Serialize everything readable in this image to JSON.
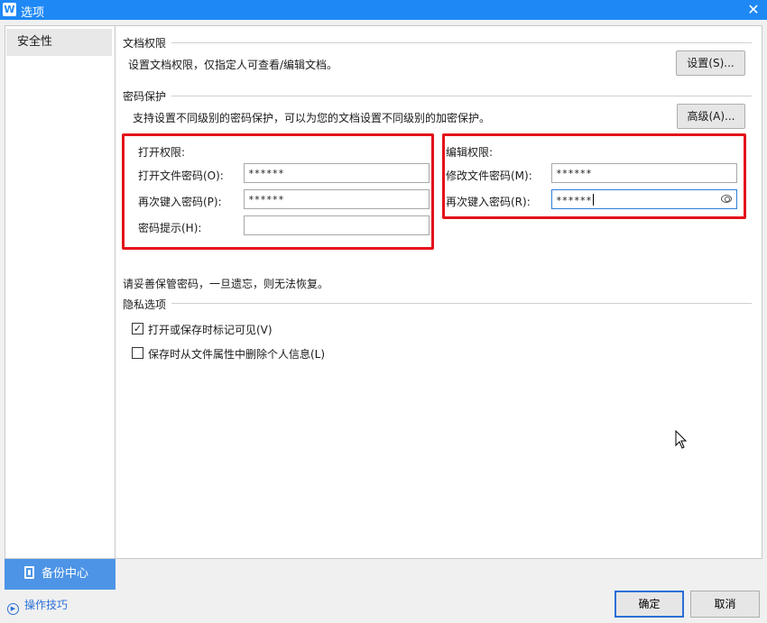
{
  "window": {
    "title": "选项",
    "app_icon_letter": "W",
    "close_glyph": "✕"
  },
  "sidebar": {
    "items": [
      {
        "label": "安全性",
        "selected": true
      }
    ],
    "backup_label": "备份中心",
    "tips_label": "操作技巧"
  },
  "doc_permission": {
    "title": "文档权限",
    "desc": "设置文档权限，仅指定人可查看/编辑文档。",
    "button": "设置(S)..."
  },
  "password": {
    "title": "密码保护",
    "desc": "支持设置不同级别的密码保护，可以为您的文档设置不同级别的加密保护。",
    "advanced_button": "高级(A)...",
    "open": {
      "title": "打开权限:",
      "password_label": "打开文件密码(O):",
      "password_value": "******",
      "confirm_label": "再次键入密码(P):",
      "confirm_value": "******",
      "hint_label": "密码提示(H):",
      "hint_value": ""
    },
    "edit": {
      "title": "编辑权限:",
      "password_label": "修改文件密码(M):",
      "password_value": "******",
      "confirm_label": "再次键入密码(R):",
      "confirm_value": "******"
    },
    "warning": "请妥善保管密码，一旦遗忘，则无法恢复。"
  },
  "privacy": {
    "title": "隐私选项",
    "options": [
      {
        "label": "打开或保存时标记可见(V)",
        "checked": true
      },
      {
        "label": "保存时从文件属性中删除个人信息(L)",
        "checked": false
      }
    ]
  },
  "footer": {
    "ok": "确定",
    "cancel": "取消"
  },
  "colors": {
    "accent": "#1e88f5",
    "highlight_box": "#e4121a",
    "link": "#2b6fd6"
  }
}
